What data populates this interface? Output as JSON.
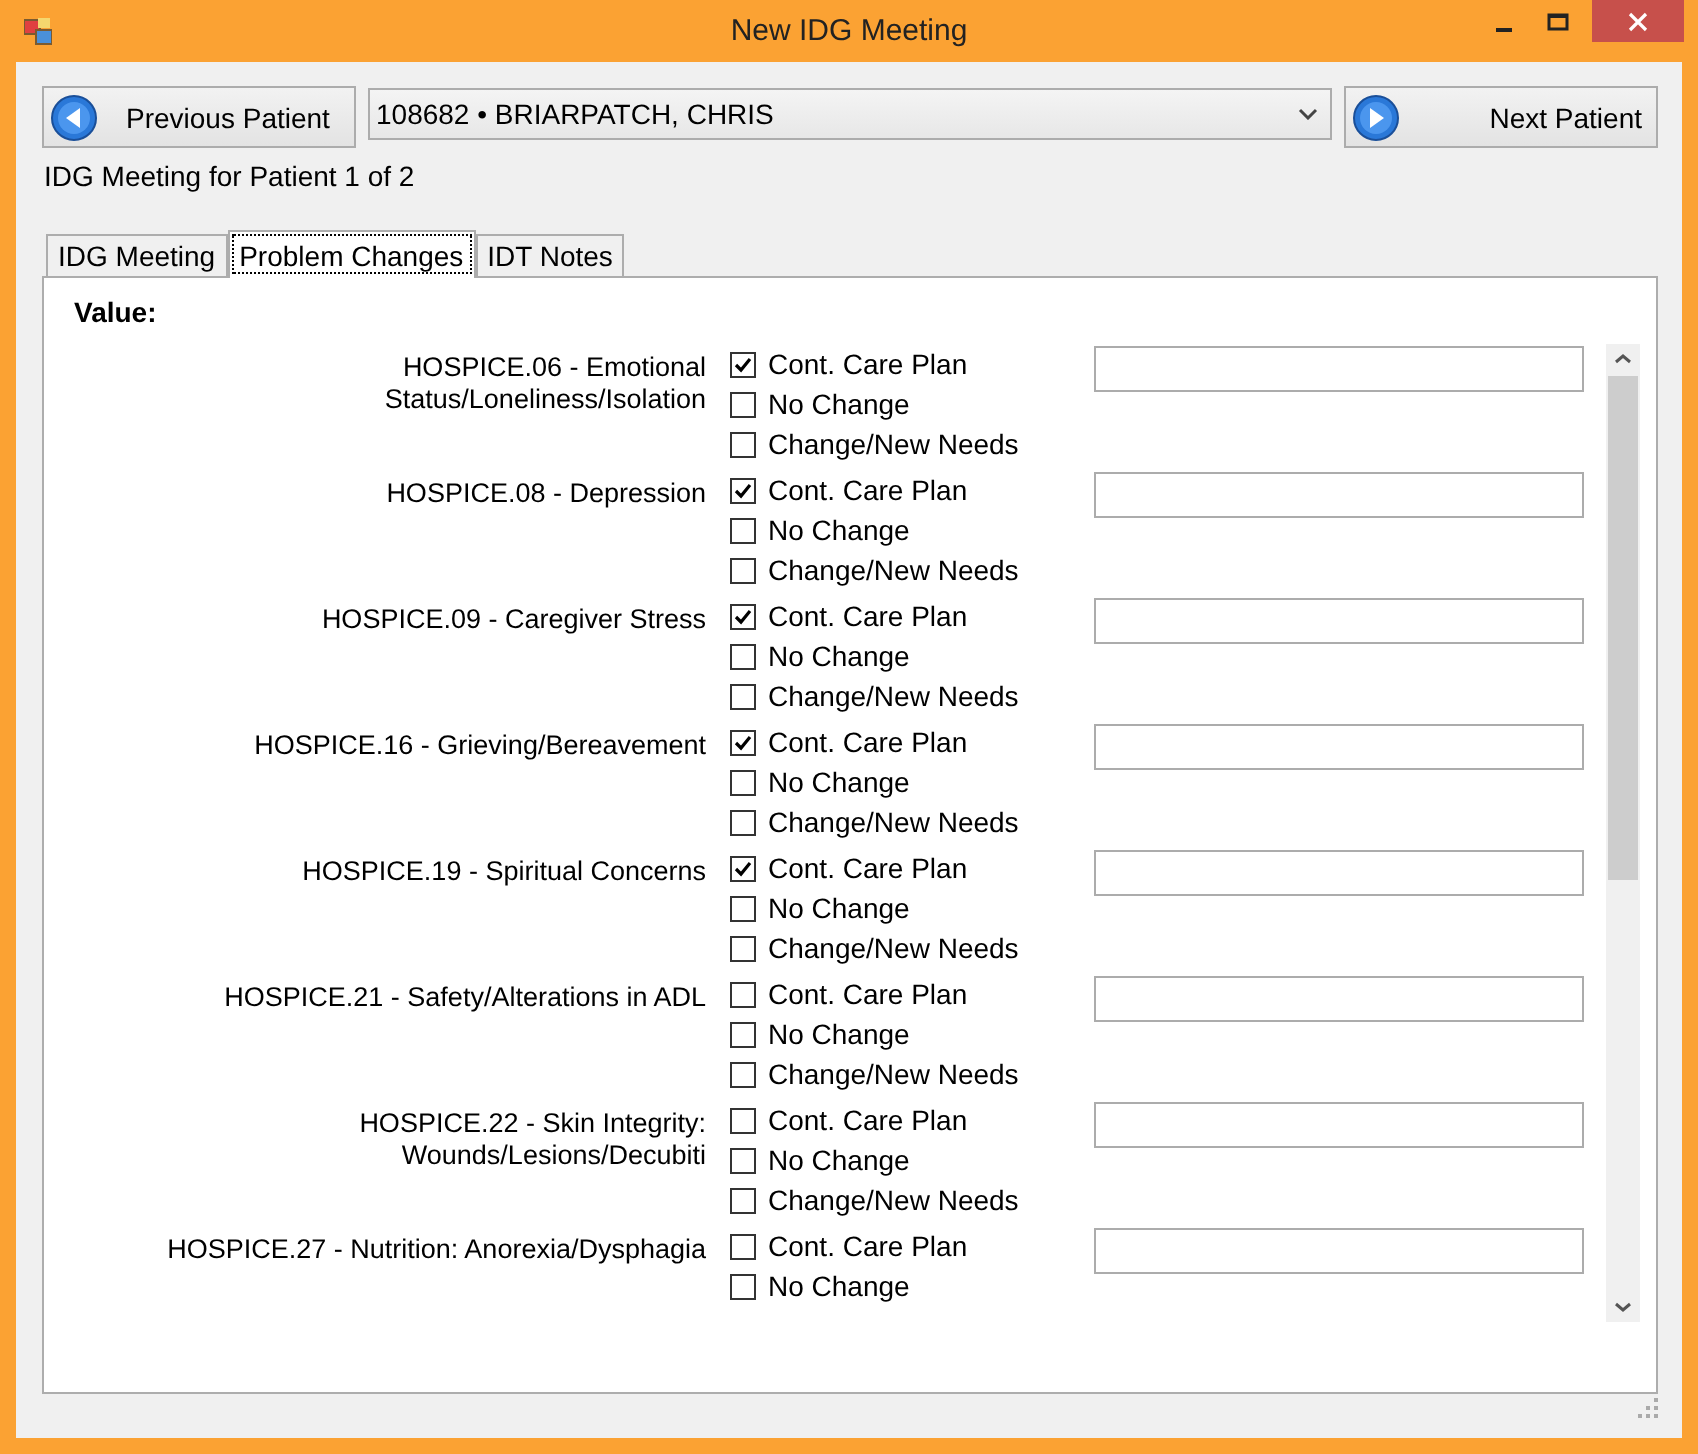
{
  "window": {
    "title": "New IDG Meeting"
  },
  "navigation": {
    "previous_button": "Previous Patient",
    "patient_select": "108682 • BRIARPATCH, CHRIS",
    "next_button": "Next Patient",
    "patient_counter": "IDG Meeting for Patient 1 of 2"
  },
  "tabs": [
    {
      "label": "IDG Meeting",
      "selected": false
    },
    {
      "label": "Problem Changes",
      "selected": true
    },
    {
      "label": "IDT Notes",
      "selected": false
    }
  ],
  "panel": {
    "heading": "Value:",
    "problems": [
      {
        "label": "HOSPICE.06 - Emotional Status/Loneliness/Isolation",
        "options": [
          {
            "label": "Cont. Care Plan",
            "checked": true
          },
          {
            "label": "No Change",
            "checked": false
          },
          {
            "label": "Change/New Needs",
            "checked": false
          }
        ]
      },
      {
        "label": "HOSPICE.08 - Depression",
        "options": [
          {
            "label": "Cont. Care Plan",
            "checked": true
          },
          {
            "label": "No Change",
            "checked": false
          },
          {
            "label": "Change/New Needs",
            "checked": false
          }
        ]
      },
      {
        "label": "HOSPICE.09 - Caregiver Stress",
        "options": [
          {
            "label": "Cont. Care Plan",
            "checked": true
          },
          {
            "label": "No Change",
            "checked": false
          },
          {
            "label": "Change/New Needs",
            "checked": false
          }
        ]
      },
      {
        "label": "HOSPICE.16 - Grieving/Bereavement",
        "options": [
          {
            "label": "Cont. Care Plan",
            "checked": true
          },
          {
            "label": "No Change",
            "checked": false
          },
          {
            "label": "Change/New Needs",
            "checked": false
          }
        ]
      },
      {
        "label": "HOSPICE.19 - Spiritual Concerns",
        "options": [
          {
            "label": "Cont. Care Plan",
            "checked": true
          },
          {
            "label": "No Change",
            "checked": false
          },
          {
            "label": "Change/New Needs",
            "checked": false
          }
        ]
      },
      {
        "label": "HOSPICE.21 - Safety/Alterations in ADL",
        "options": [
          {
            "label": "Cont. Care Plan",
            "checked": false
          },
          {
            "label": "No Change",
            "checked": false
          },
          {
            "label": "Change/New Needs",
            "checked": false
          }
        ]
      },
      {
        "label": "HOSPICE.22 - Skin Integrity: Wounds/Lesions/Decubiti",
        "options": [
          {
            "label": "Cont. Care Plan",
            "checked": false
          },
          {
            "label": "No Change",
            "checked": false
          },
          {
            "label": "Change/New Needs",
            "checked": false
          }
        ]
      },
      {
        "label": "HOSPICE.27 - Nutrition: Anorexia/Dysphagia",
        "options": [
          {
            "label": "Cont. Care Plan",
            "checked": false
          },
          {
            "label": "No Change",
            "checked": false
          }
        ]
      }
    ]
  }
}
